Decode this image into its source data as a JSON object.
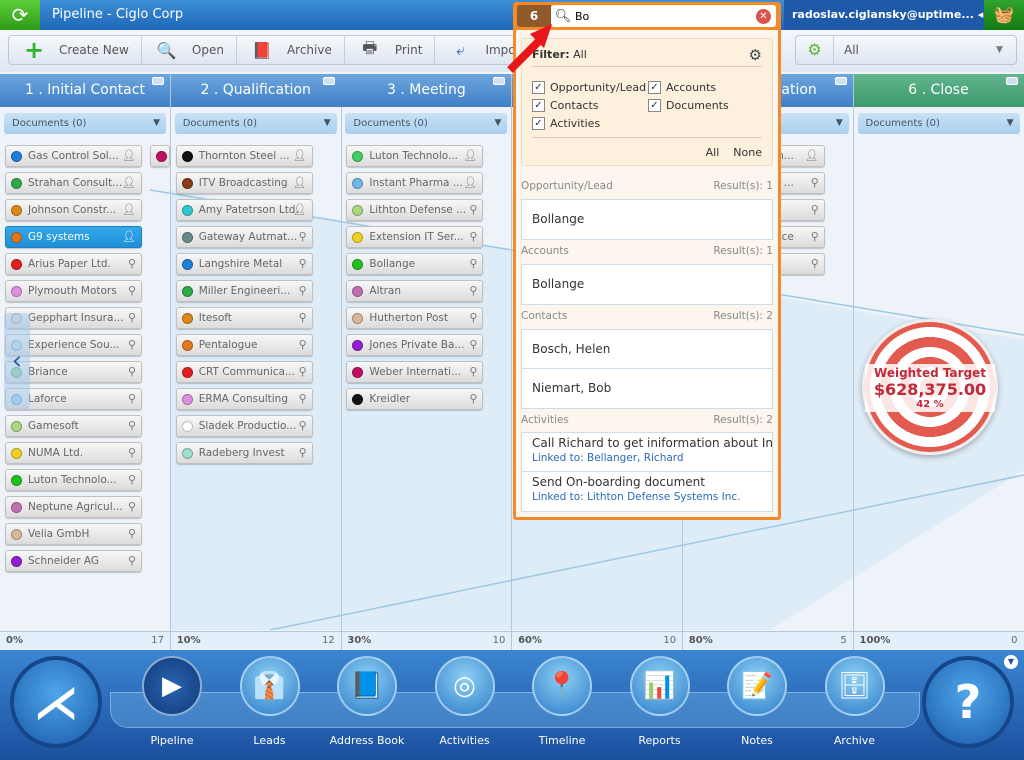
{
  "titlebar": {
    "title": "Pipeline - Ciglo Corp",
    "user": "radoslav.ciglansky@uptime...",
    "refresh_icon": "refresh-icon",
    "basket_icon": "basket-icon"
  },
  "toolbar": {
    "buttons": [
      {
        "label": "Create New",
        "icon": "plus-icon"
      },
      {
        "label": "Open",
        "icon": "magnifier-icon"
      },
      {
        "label": "Archive",
        "icon": "archive-book-icon"
      },
      {
        "label": "Print",
        "icon": "printer-icon"
      },
      {
        "label": "Import",
        "icon": "import-icon"
      }
    ],
    "filter_value": "All"
  },
  "columns": [
    {
      "title": "1 . Initial Contact",
      "docs": "Documents (0)",
      "percent": "0%",
      "count": "17",
      "cards": [
        {
          "name": "Gas Control Sol...",
          "color": "#1e7fd8",
          "type": "person"
        },
        {
          "name": "Strahan Consult...",
          "color": "#2fa84a",
          "type": "person"
        },
        {
          "name": "Johnson Constr...",
          "color": "#d98a1a",
          "type": "person"
        },
        {
          "name": "G9 systems",
          "color": "#e0781f",
          "type": "person",
          "selected": true
        },
        {
          "name": "Arius Paper Ltd.",
          "color": "#e02020",
          "type": "org"
        },
        {
          "name": "Plymouth Motors",
          "color": "#e090e0",
          "type": "org"
        },
        {
          "name": "Gepphart Insura...",
          "color": "#dddddd",
          "type": "org"
        },
        {
          "name": "Experience Sou...",
          "color": "#bfe0f0",
          "type": "org"
        },
        {
          "name": "Briance",
          "color": "#8fd8a8",
          "type": "org"
        },
        {
          "name": "Laforce",
          "color": "#9ed0f0",
          "type": "org"
        },
        {
          "name": "Gamesoft",
          "color": "#a8d880",
          "type": "org"
        },
        {
          "name": "NUMA Ltd.",
          "color": "#f0d020",
          "type": "org"
        },
        {
          "name": "Luton Technolo...",
          "color": "#20c020",
          "type": "org"
        },
        {
          "name": "Neptune Agricul...",
          "color": "#c070b0",
          "type": "org"
        },
        {
          "name": "Velia GmbH",
          "color": "#d8b898",
          "type": "org"
        },
        {
          "name": "Schneider AG",
          "color": "#9020d0",
          "type": "org"
        }
      ]
    },
    {
      "title": "2 . Qualification",
      "docs": "Documents (0)",
      "percent": "10%",
      "count": "12",
      "cards": [
        {
          "name": "Thornton Steel ...",
          "color": "#111111",
          "type": "person"
        },
        {
          "name": "ITV Broadcasting",
          "color": "#8a3a1a",
          "type": "person"
        },
        {
          "name": "Amy Patetrson Ltd.",
          "color": "#30c8d0",
          "type": "person"
        },
        {
          "name": "Gateway Autmat...",
          "color": "#6a8a8a",
          "type": "org"
        },
        {
          "name": "Langshire Metal",
          "color": "#1e7fd8",
          "type": "org"
        },
        {
          "name": "Miller Engineeri...",
          "color": "#2fa84a",
          "type": "org"
        },
        {
          "name": "Itesoft",
          "color": "#d98a1a",
          "type": "org"
        },
        {
          "name": "Pentalogue",
          "color": "#e0781f",
          "type": "org"
        },
        {
          "name": "CRT Communica...",
          "color": "#e02020",
          "type": "org"
        },
        {
          "name": "ERMA Consulting",
          "color": "#e090e0",
          "type": "org"
        },
        {
          "name": "Sladek Productio...",
          "color": "#ffffff",
          "type": "org"
        },
        {
          "name": "Radeberg Invest",
          "color": "#a0e0d0",
          "type": "org"
        }
      ]
    },
    {
      "title": "3 . Meeting",
      "docs": "Documents (0)",
      "percent": "30%",
      "count": "10",
      "cards": [
        {
          "name": "Luton Technolo...",
          "color": "#40d060",
          "type": "person"
        },
        {
          "name": "Instant Pharma ...",
          "color": "#70b8e8",
          "type": "person"
        },
        {
          "name": "Lithton Defense ...",
          "color": "#a8d880",
          "type": "org"
        },
        {
          "name": "Extension IT Ser...",
          "color": "#f0d020",
          "type": "org"
        },
        {
          "name": "Bollange",
          "color": "#20c020",
          "type": "org"
        },
        {
          "name": "Altran",
          "color": "#c070b0",
          "type": "org"
        },
        {
          "name": "Hutherton Post",
          "color": "#d8b898",
          "type": "org"
        },
        {
          "name": "Jones Private Ba...",
          "color": "#9020d0",
          "type": "org"
        },
        {
          "name": "Weber Internati...",
          "color": "#c01060",
          "type": "org"
        },
        {
          "name": "Kreidler",
          "color": "#111111",
          "type": "org"
        }
      ]
    },
    {
      "title": "",
      "docs": "",
      "percent": "60%",
      "count": "10",
      "cards": []
    },
    {
      "title": "cation",
      "docs": "",
      "percent": "80%",
      "count": "5",
      "cards": [
        {
          "name": "n...",
          "color": "#cccccc",
          "type": "person"
        },
        {
          "name": "l ...",
          "color": "#cccccc",
          "type": "org"
        },
        {
          "name": "",
          "color": "#cccccc",
          "type": "org"
        },
        {
          "name": "ce",
          "color": "#cccccc",
          "type": "org"
        },
        {
          "name": "",
          "color": "#cccccc",
          "type": "org"
        }
      ]
    },
    {
      "title": "6 . Close",
      "docs": "Documents (0)",
      "percent": "100%",
      "count": "0",
      "cards": [],
      "accent": "#4fa87c"
    }
  ],
  "overflow_card_color": "#c01060",
  "weighted_target": {
    "label": "Weighted Target",
    "amount": "$628,375.00",
    "percent": "42 %",
    "progress": 42
  },
  "search": {
    "count": "6",
    "query": "Bo",
    "filter_label": "Filter:",
    "filter_value": "All",
    "options": [
      {
        "label": "Opportunity/Lead",
        "checked": true
      },
      {
        "label": "Accounts",
        "checked": true
      },
      {
        "label": "Contacts",
        "checked": true
      },
      {
        "label": "Documents",
        "checked": true
      },
      {
        "label": "Activities",
        "checked": true
      }
    ],
    "all": "All",
    "none": "None",
    "sections": [
      {
        "title": "Opportunity/Lead",
        "results": "Result(s): 1",
        "items": [
          "Bollange"
        ]
      },
      {
        "title": "Accounts",
        "results": "Result(s): 1",
        "items": [
          "Bollange"
        ]
      },
      {
        "title": "Contacts",
        "results": "Result(s): 2",
        "items": [
          "Bosch, Helen",
          "Niemart, Bob"
        ]
      },
      {
        "title": "Activities",
        "results": "Result(s): 2",
        "activities": [
          {
            "title": "Call Richard to get iniformation about In...",
            "linked": "Linked to: Bellanger, Richard"
          },
          {
            "title": "Send On-boarding document",
            "linked": "Linked to: Lithton Defense Systems Inc."
          }
        ]
      }
    ]
  },
  "dock": {
    "items": [
      {
        "label": "Pipeline",
        "active": true
      },
      {
        "label": "Leads"
      },
      {
        "label": "Address Book"
      },
      {
        "label": "Activities"
      },
      {
        "label": "Timeline"
      },
      {
        "label": "Reports"
      },
      {
        "label": "Notes"
      },
      {
        "label": "Archive"
      }
    ]
  },
  "colors": {
    "popup_border": "#f58a2a",
    "header_blue": "#4f8fd2",
    "close_green": "#4fa87c",
    "selected_card": "#2a9be0"
  }
}
